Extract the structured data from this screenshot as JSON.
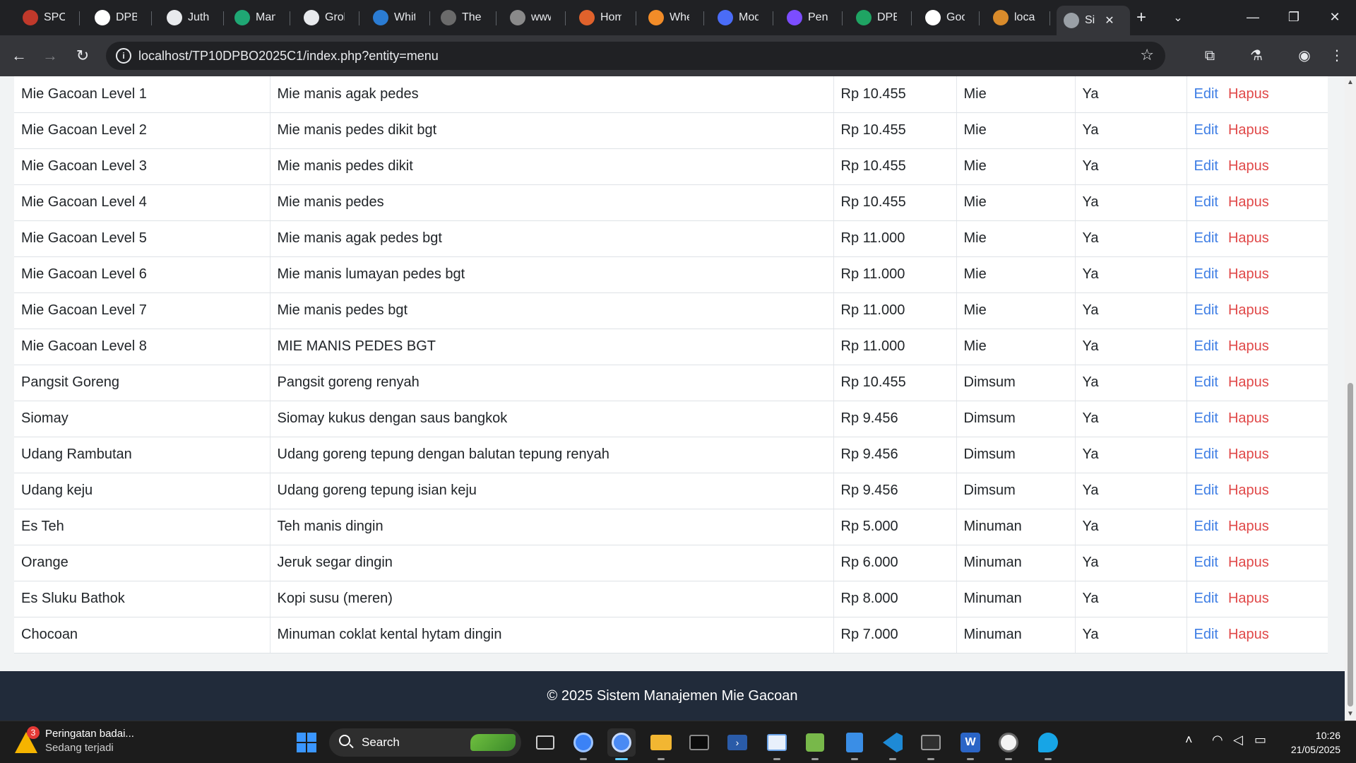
{
  "browser": {
    "tabs": [
      {
        "title": "SPOT",
        "color": "#c0392b"
      },
      {
        "title": "DPBO",
        "color": "#ffffff"
      },
      {
        "title": "Juther",
        "color": "#e8eaed"
      },
      {
        "title": "Mana",
        "color": "#1fa774"
      },
      {
        "title": "Grok",
        "color": "#e8eaed"
      },
      {
        "title": "White",
        "color": "#2b7cd3"
      },
      {
        "title": "The U",
        "color": "#6b6b6b"
      },
      {
        "title": "www.",
        "color": "#8a8a8a"
      },
      {
        "title": "Home",
        "color": "#e0622c"
      },
      {
        "title": "Wher",
        "color": "#f28c28"
      },
      {
        "title": "Modu",
        "color": "#4a6cf7"
      },
      {
        "title": "Peng",
        "color": "#7c4dff"
      },
      {
        "title": "DPBO",
        "color": "#1fa463"
      },
      {
        "title": "Goog",
        "color": "#ffffff"
      },
      {
        "title": "localh",
        "color": "#d98b2b"
      },
      {
        "title": "Si",
        "color": "#9aa0a6"
      }
    ],
    "url": "localhost/TP10DPBO2025C1/index.php?entity=menu"
  },
  "menu_table": {
    "edit_label": "Edit",
    "delete_label": "Hapus",
    "rows": [
      {
        "name": "Mie Gacoan Level 1",
        "description": "Mie manis agak pedes",
        "price": "Rp 10.455",
        "category": "Mie",
        "available": "Ya"
      },
      {
        "name": "Mie Gacoan Level 2",
        "description": "Mie manis pedes dikit bgt",
        "price": "Rp 10.455",
        "category": "Mie",
        "available": "Ya"
      },
      {
        "name": "Mie Gacoan Level 3",
        "description": "Mie manis pedes dikit",
        "price": "Rp 10.455",
        "category": "Mie",
        "available": "Ya"
      },
      {
        "name": "Mie Gacoan Level 4",
        "description": "Mie manis pedes",
        "price": "Rp 10.455",
        "category": "Mie",
        "available": "Ya"
      },
      {
        "name": "Mie Gacoan Level 5",
        "description": "Mie manis agak pedes bgt",
        "price": "Rp 11.000",
        "category": "Mie",
        "available": "Ya"
      },
      {
        "name": "Mie Gacoan Level 6",
        "description": "Mie manis lumayan pedes bgt",
        "price": "Rp 11.000",
        "category": "Mie",
        "available": "Ya"
      },
      {
        "name": "Mie Gacoan Level 7",
        "description": "Mie manis pedes bgt",
        "price": "Rp 11.000",
        "category": "Mie",
        "available": "Ya"
      },
      {
        "name": "Mie Gacoan Level 8",
        "description": "MIE MANIS PEDES BGT",
        "price": "Rp 11.000",
        "category": "Mie",
        "available": "Ya"
      },
      {
        "name": "Pangsit Goreng",
        "description": "Pangsit goreng renyah",
        "price": "Rp 10.455",
        "category": "Dimsum",
        "available": "Ya"
      },
      {
        "name": "Siomay",
        "description": "Siomay kukus dengan saus bangkok",
        "price": "Rp 9.456",
        "category": "Dimsum",
        "available": "Ya"
      },
      {
        "name": "Udang Rambutan",
        "description": "Udang goreng tepung dengan balutan tepung renyah",
        "price": "Rp 9.456",
        "category": "Dimsum",
        "available": "Ya"
      },
      {
        "name": "Udang keju",
        "description": "Udang goreng tepung isian keju",
        "price": "Rp 9.456",
        "category": "Dimsum",
        "available": "Ya"
      },
      {
        "name": "Es Teh",
        "description": "Teh manis dingin",
        "price": "Rp 5.000",
        "category": "Minuman",
        "available": "Ya"
      },
      {
        "name": "Orange",
        "description": "Jeruk segar dingin",
        "price": "Rp 6.000",
        "category": "Minuman",
        "available": "Ya"
      },
      {
        "name": "Es Sluku Bathok",
        "description": "Kopi susu (meren)",
        "price": "Rp 8.000",
        "category": "Minuman",
        "available": "Ya"
      },
      {
        "name": "Chocoan",
        "description": "Minuman coklat kental hytam dingin",
        "price": "Rp 7.000",
        "category": "Minuman",
        "available": "Ya"
      }
    ]
  },
  "footer": {
    "text": "© 2025 Sistem Manajemen Mie Gacoan"
  },
  "taskbar": {
    "weather_badge": "3",
    "weather_title": "Peringatan badai...",
    "weather_sub": "Sedang terjadi",
    "search_label": "Search",
    "time": "10:26",
    "date": "21/05/2025"
  }
}
